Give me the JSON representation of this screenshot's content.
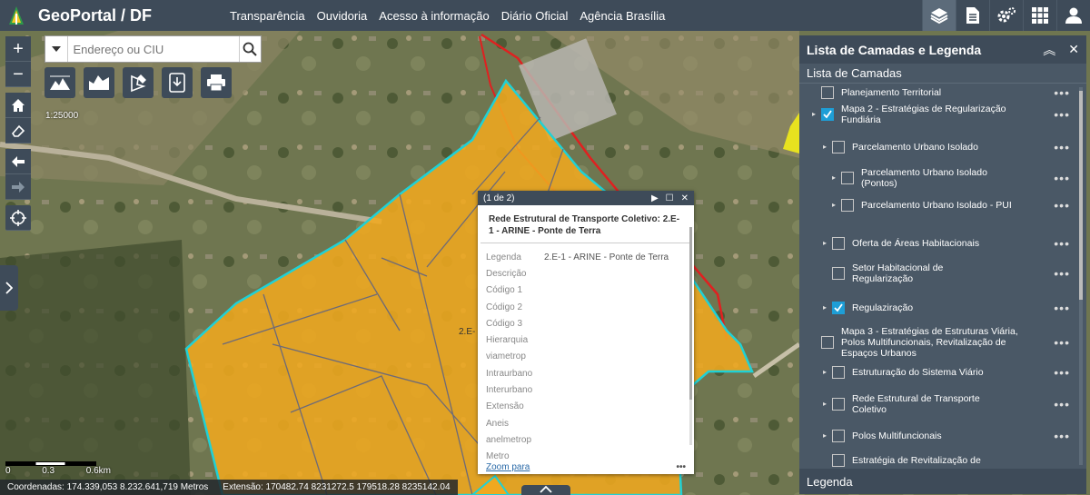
{
  "header": {
    "title": "GeoPortal / DF",
    "nav": [
      "Transparência",
      "Ouvidoria",
      "Acesso à informação",
      "Diário Oficial",
      "Agência Brasília"
    ],
    "tools": [
      "layers-icon",
      "document-icon",
      "settings-icon",
      "grid-apps-icon",
      "user-icon"
    ]
  },
  "search": {
    "placeholder": "Endereço ou CIU"
  },
  "map": {
    "scale_ratio": "1:25000",
    "scalebar": [
      "0",
      "0.3",
      "0.6km"
    ],
    "map_label": "2.E-",
    "status": {
      "coords": "Coordenadas: 174.339,053 8.232.641,719 Metros",
      "extent": "Extensão: 170482.74 8231272.5 179518.28 8235142.04"
    },
    "colors": {
      "polygon_fill": "#f0a81f",
      "polygon_border": "#1fd1d6",
      "parcel_line": "#6d6a78",
      "red_line": "#e02020"
    }
  },
  "popup": {
    "count": "(1 de 2)",
    "title": "Rede Estrutural de Transporte Coletivo: 2.E-1 - ARINE - Ponte de Terra",
    "attributes": [
      {
        "k": "Legenda",
        "v": "2.E-1 - ARINE - Ponte de Terra"
      },
      {
        "k": "Descrição",
        "v": ""
      },
      {
        "k": "Código 1",
        "v": ""
      },
      {
        "k": "Código 2",
        "v": ""
      },
      {
        "k": "Código 3",
        "v": ""
      },
      {
        "k": "Hierarquia",
        "v": ""
      },
      {
        "k": "viametrop",
        "v": ""
      },
      {
        "k": "Intraurbano",
        "v": ""
      },
      {
        "k": "Interurbano",
        "v": ""
      },
      {
        "k": "Extensão",
        "v": ""
      },
      {
        "k": "Aneis",
        "v": ""
      },
      {
        "k": "anelmetrop",
        "v": ""
      },
      {
        "k": "Metro",
        "v": ""
      }
    ],
    "zoom_link": "Zoom para",
    "more": "•••"
  },
  "panel": {
    "title": "Lista de Camadas e Legenda",
    "subtitle": "Lista de Camadas",
    "footer": "Legenda",
    "layers": [
      {
        "label": "Planejamento Territorial",
        "checked": false
      },
      {
        "label": "Mapa 2 - Estratégias de Regularização Fundiária",
        "checked": true
      },
      {
        "label": "Parcelamento Urbano Isolado",
        "checked": false
      },
      {
        "label": "Parcelamento Urbano Isolado (Pontos)",
        "checked": false
      },
      {
        "label": "Parcelamento Urbano Isolado - PUI",
        "checked": false
      },
      {
        "label": "Oferta de Áreas Habitacionais",
        "checked": false
      },
      {
        "label": "Setor Habitacional de Regularização",
        "checked": false
      },
      {
        "label": "Regulaziração",
        "checked": true
      },
      {
        "label": "Mapa 3 - Estratégias de Estruturas Viária, Polos Multifuncionais, Revitalização de Espaços Urbanos",
        "checked": false
      },
      {
        "label": "Estruturação do Sistema Viário",
        "checked": false
      },
      {
        "label": "Rede Estrutural de Transporte Coletivo",
        "checked": false
      },
      {
        "label": "Polos Multifuncionais",
        "checked": false
      },
      {
        "label": "Estratégia de Revitalização de",
        "checked": false
      }
    ]
  }
}
